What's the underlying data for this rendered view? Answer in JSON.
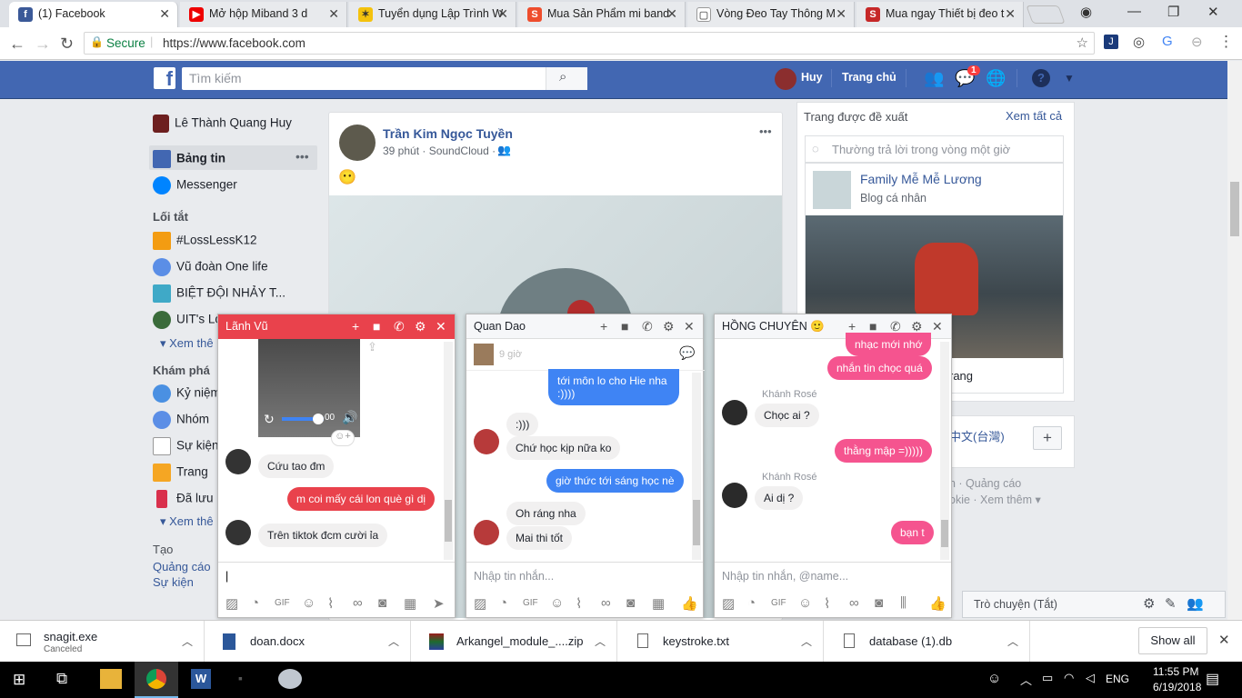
{
  "browser": {
    "tabs": [
      {
        "label": "(1) Facebook",
        "active": true
      },
      {
        "label": "Mở hộp Miband 3 d"
      },
      {
        "label": "Tuyển dụng Lập Trình W"
      },
      {
        "label": "Mua Sản Phẩm mi band"
      },
      {
        "label": "Vòng Đeo Tay Thông M"
      },
      {
        "label": "Mua ngay Thiết bị đeo t"
      }
    ],
    "secure_label": "Secure",
    "url": "https://www.facebook.com"
  },
  "fb_header": {
    "search_placeholder": "Tìm kiếm",
    "user": "Huy",
    "home": "Trang chủ",
    "message_badge": "1"
  },
  "left_nav": {
    "profile": "Lê Thành Quang Huy",
    "news_feed": "Bảng tin",
    "messenger": "Messenger",
    "shortcuts_heading": "Lối tắt",
    "shortcuts": [
      "#LossLessK12",
      "Vũ đoàn One life",
      "BIỆT ĐỘI NHẢY T...",
      "UIT's Lo"
    ],
    "see_more_1": "Xem thê",
    "explore_heading": "Khám phá",
    "explore": [
      "Kỷ niệm",
      "Nhóm",
      "Sự kiện",
      "Trang",
      "Đã lưu"
    ],
    "see_more_2": "Xem thê",
    "create_heading": "Tạo",
    "create": [
      "Quảng cáo",
      "Sự kiện"
    ]
  },
  "post": {
    "author": "Trần Kim Ngọc Tuyền",
    "meta": "39 phút · SoundCloud ·",
    "emoji": "😶",
    "more": "•••"
  },
  "right_col": {
    "heading": "Trang được đề xuất",
    "see_all": "Xem tất cả",
    "response_note": "Thường trả lời trong vòng một giờ",
    "page_name": "Family Mễ Mễ Lương",
    "page_type": "Blog cá nhân",
    "page_label_tail": "rang",
    "lang_text": "中文(台灣)",
    "footer1": "n · Quảng cáo",
    "footer2": "okie · Xem thêm ▾",
    "chat_bar": "Trò chuyện (Tắt)"
  },
  "chats": [
    {
      "title": "Lãnh Vũ",
      "color": "#e9424c",
      "video_time": "00",
      "messages": [
        {
          "from": "them",
          "text": "Cứu tao đm"
        },
        {
          "from": "me",
          "text": "m coi mấy cái lon què gì dị"
        },
        {
          "from": "them",
          "text": "Trên tiktok đcm cười ỉa"
        }
      ],
      "input_value": "|"
    },
    {
      "title": "Quan Dao",
      "color": "#f6f7f9",
      "time_label": "9 giờ",
      "messages": [
        {
          "from": "me",
          "text": "tới môn lo cho Hie nha :))))"
        },
        {
          "from": "them",
          "text": ":)))"
        },
        {
          "from": "them",
          "text": "Chứ học kịp nữa ko"
        },
        {
          "from": "me",
          "text": "giờ thức tới sáng học nè"
        },
        {
          "from": "them",
          "text": "Oh ráng nha"
        },
        {
          "from": "them",
          "text": "Mai thi tốt"
        }
      ],
      "input_placeholder": "Nhập tin nhắn..."
    },
    {
      "title": "HỒNG CHUYÊN 🙂",
      "color": "#f6f7f9",
      "messages": [
        {
          "from": "me",
          "text": "nhạc mới nhớ"
        },
        {
          "from": "me",
          "text": "nhắn tin chọc quá"
        },
        {
          "from": "name",
          "text": "Khánh Rosé"
        },
        {
          "from": "them",
          "text": "Chọc ai ?"
        },
        {
          "from": "me",
          "text": "thằng mập =)))))"
        },
        {
          "from": "name",
          "text": "Khánh Rosé"
        },
        {
          "from": "them",
          "text": "Ai dị ?"
        },
        {
          "from": "me",
          "text": "bạn t"
        }
      ],
      "input_placeholder": "Nhập tin nhắn, @name..."
    }
  ],
  "downloads": [
    {
      "name": "snagit.exe",
      "status": "Canceled"
    },
    {
      "name": "doan.docx"
    },
    {
      "name": "Arkangel_module_....zip"
    },
    {
      "name": "keystroke.txt"
    },
    {
      "name": "database (1).db"
    }
  ],
  "show_all": "Show all",
  "taskbar": {
    "lang": "ENG",
    "time": "11:55 PM",
    "date": "6/19/2018"
  }
}
